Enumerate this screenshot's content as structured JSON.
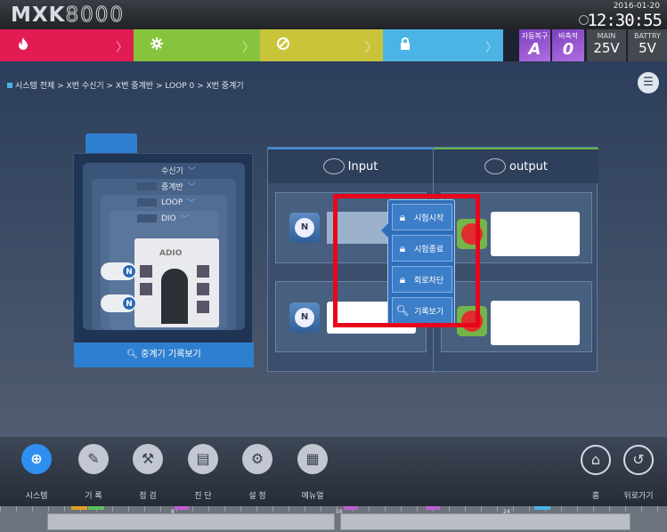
{
  "header": {
    "logo_bold": "MXK",
    "logo_thin": "8000",
    "date": "2016-01-20",
    "time": "12:30:55"
  },
  "status": {
    "fire_icon": "fire-icon",
    "fault_icon": "fault-gear-icon",
    "block_icon": "block-circle-icon",
    "lock_icon": "lock-icon",
    "chevron": "〉",
    "auto_label": "자동복구",
    "auto_value": "A",
    "nonfire_label": "비축적",
    "nonfire_value": "0",
    "main_label": "MAIN",
    "main_value": "25V",
    "battery_label": "BATTRY",
    "battery_value": "5V"
  },
  "breadcrumb": "시스템 전체 > X번 수신기 > X번 중계반 > LOOP 0 > X번 중계기",
  "device": {
    "tiers": [
      {
        "label": "수신기"
      },
      {
        "label": "중계반"
      },
      {
        "label": "LOOP"
      },
      {
        "label": "DIO"
      }
    ],
    "brand": "ADIO",
    "n_badge": "N",
    "history_button": "중계기 기록보기"
  },
  "io": {
    "input_label": "Input",
    "output_label": "output",
    "gauge_letter": "N"
  },
  "context_menu": [
    {
      "label": "시험시작",
      "icon": "lock-play-icon"
    },
    {
      "label": "시험종료",
      "icon": "lock-stop-icon"
    },
    {
      "label": "회로차단",
      "icon": "lock-icon"
    },
    {
      "label": "기록보기",
      "icon": "record-search-icon"
    }
  ],
  "dock": {
    "items": [
      {
        "label": "시스템",
        "icon": "globe-icon"
      },
      {
        "label": "기 록",
        "icon": "pencil-icon"
      },
      {
        "label": "점 검",
        "icon": "inspect-icon"
      },
      {
        "label": "진 단",
        "icon": "clipboard-icon"
      },
      {
        "label": "설 정",
        "icon": "gear-icon"
      },
      {
        "label": "메뉴얼",
        "icon": "manual-icon"
      }
    ],
    "home_label": "홈",
    "back_label": "뒤로가기"
  },
  "footer": {
    "tick_labels": [
      "8",
      "16",
      "24"
    ]
  },
  "colors": {
    "fire": "#e21b52",
    "fault": "#87c43d",
    "block": "#c9c43a",
    "lock": "#4cb4e5",
    "highlight_box": "#e8061c",
    "accent": "#2f7fd0"
  }
}
